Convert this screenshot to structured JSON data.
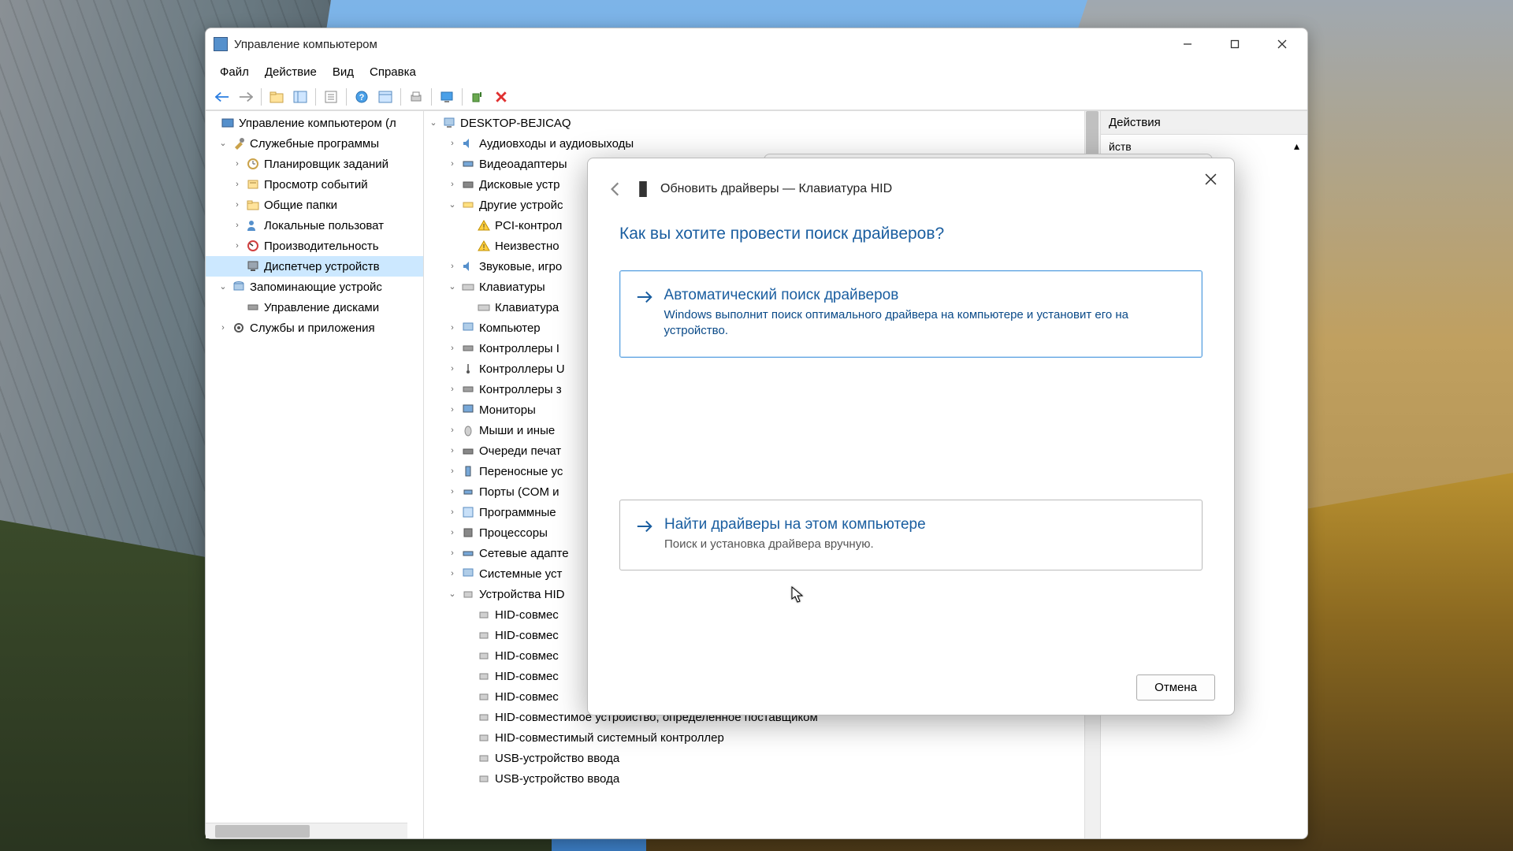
{
  "window": {
    "title": "Управление компьютером",
    "menu": {
      "file": "Файл",
      "action": "Действие",
      "view": "Вид",
      "help": "Справка"
    }
  },
  "nav": {
    "root": "Управление компьютером (л",
    "sys_tools": "Служебные программы",
    "scheduler": "Планировщик заданий",
    "event": "Просмотр событий",
    "shared": "Общие папки",
    "local_users": "Локальные пользоват",
    "perf": "Производительность",
    "devmgr": "Диспетчер устройств",
    "storage": "Запоминающие устройс",
    "diskmgmt": "Управление дисками",
    "services": "Службы и приложения"
  },
  "dev": {
    "host": "DESKTOP-BEJICAQ",
    "audio": "Аудиовходы и аудиовыходы",
    "video": "Видеоадаптеры",
    "disk": "Дисковые устр",
    "other": "Другие устройс",
    "pci": "PCI-контрол",
    "unknown": "Неизвестно",
    "sound": "Звуковые, игро",
    "keyboards": "Клавиатуры",
    "keyboard1": "Клавиатура",
    "computer": "Компьютер",
    "ctrl_ide": "Контроллеры I",
    "ctrl_usb": "Контроллеры U",
    "ctrl_stor": "Контроллеры з",
    "monitors": "Мониторы",
    "mice": "Мыши и иные",
    "print": "Очереди печат",
    "portable": "Переносные ус",
    "ports": "Порты (COM и",
    "software": "Программные",
    "cpu": "Процессоры",
    "net": "Сетевые адапте",
    "sysdev": "Системные уст",
    "hid": "Устройства HID",
    "hid_item": "HID-совмес",
    "hid_vendor": "HID-совместимое устройство, определенное поставщиком",
    "hid_sys": "HID-совместимый системный контроллер",
    "usb_input": "USB-устройство ввода"
  },
  "actions": {
    "header": "Действия",
    "item": "йств"
  },
  "dialog": {
    "title": "Обновить драйверы — Клавиатура HID",
    "question": "Как вы хотите провести поиск драйверов?",
    "opt1_title": "Автоматический поиск драйверов",
    "opt1_desc": "Windows выполнит поиск оптимального драйвера на компьютере и установит его на устройство.",
    "opt2_title": "Найти драйверы на этом компьютере",
    "opt2_desc": "Поиск и установка драйвера вручную.",
    "cancel": "Отмена"
  }
}
